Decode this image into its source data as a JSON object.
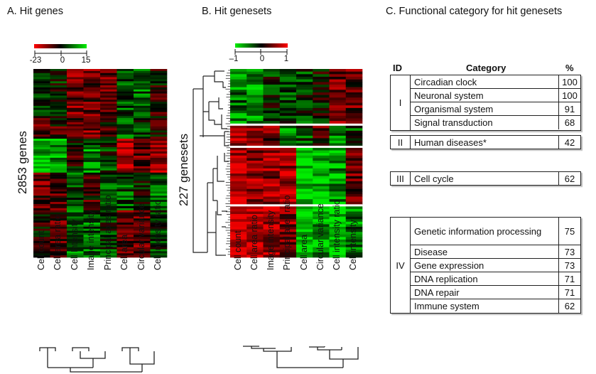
{
  "panels": {
    "a": {
      "title": "A. Hit genes",
      "row_label": "2853 genes"
    },
    "b": {
      "title": "B. Hit genesets",
      "row_label": "227 genesets"
    },
    "c": {
      "title": "C. Functional category for hit genesets"
    }
  },
  "chart_data": [
    {
      "type": "heatmap",
      "title": "A. Hit genes",
      "ylabel": "2853 genes",
      "n_rows": 2853,
      "color_scale": {
        "min": -23,
        "mid": 0,
        "max": 15,
        "colors": [
          "#ff0000",
          "#000000",
          "#00ff00"
        ],
        "tick_labels": [
          "-23",
          "0",
          "15"
        ]
      },
      "columns": [
        "Cell count",
        "Cell area ratio",
        "Cell Intensity",
        "Image intensity",
        "Principal axes ratio",
        "Cell area",
        "Circular variance",
        "Cell intensity ratio"
      ],
      "column_dendrogram": "((Cell count,Cell area ratio),((Cell Intensity,Image intensity),Principal axes ratio)),((Cell area,Circular variance),Cell intensity ratio)",
      "row_blocks_approx": [
        {
          "fraction": 0.25,
          "pattern": [
            -0.1,
            -0.1,
            0.5,
            0.4,
            0.4,
            -0.3,
            -0.4,
            0.1
          ]
        },
        {
          "fraction": 0.12,
          "pattern": [
            0.3,
            0.2,
            0.3,
            0.5,
            0.2,
            -0.5,
            -0.2,
            0.1
          ]
        },
        {
          "fraction": 0.18,
          "pattern": [
            -0.8,
            -0.7,
            0.1,
            -0.5,
            -0.2,
            0.8,
            0.4,
            0.7
          ]
        },
        {
          "fraction": 0.2,
          "pattern": [
            0.4,
            0.4,
            -0.3,
            0.2,
            -0.4,
            -0.3,
            -0.1,
            -0.5
          ]
        },
        {
          "fraction": 0.25,
          "pattern": [
            0.0,
            0.3,
            -0.5,
            -0.4,
            -0.2,
            0.4,
            0.4,
            -0.2
          ]
        }
      ]
    },
    {
      "type": "heatmap",
      "title": "B. Hit genesets",
      "ylabel": "227 genesets",
      "n_rows": 227,
      "color_scale": {
        "min": -1,
        "mid": 0,
        "max": 1,
        "colors": [
          "#00ff00",
          "#000000",
          "#ff0000"
        ],
        "tick_labels": [
          "–1",
          "0",
          "1"
        ]
      },
      "columns": [
        "Cell count",
        "Cell area ratio",
        "Image intensity",
        "Principal axes ratio",
        "Cell area",
        "Circular variance",
        "Cell intensity ratio",
        "Cell intensity"
      ],
      "column_dendrogram": "(((Cell count,Cell area ratio),Image intensity),Principal axes ratio),(((Cell area,Circular variance),Cell intensity ratio),Cell intensity)",
      "row_clusters": [
        {
          "fraction": 0.3,
          "pattern": [
            -0.5,
            -0.6,
            -0.1,
            -0.2,
            -0.2,
            0.0,
            0.5,
            0.4
          ]
        },
        {
          "fraction": 0.11,
          "pattern": [
            0.6,
            0.6,
            0.4,
            -0.5,
            -0.3,
            0.3,
            -0.6,
            -0.3
          ]
        },
        {
          "fraction": 0.31,
          "pattern": [
            0.8,
            0.6,
            0.6,
            0.7,
            -0.9,
            -0.8,
            -0.6,
            0.4
          ]
        },
        {
          "fraction": 0.28,
          "pattern": [
            0.95,
            0.85,
            0.7,
            0.6,
            -0.9,
            -0.7,
            -0.9,
            -0.5
          ]
        }
      ]
    },
    {
      "type": "table",
      "title": "C. Functional category for hit genesets",
      "headers": [
        "ID",
        "Category",
        "%"
      ],
      "groups": [
        {
          "id": "I",
          "rows": [
            {
              "category": "Circadian clock",
              "pct": 100
            },
            {
              "category": "Neuronal system",
              "pct": 100
            },
            {
              "category": "Organismal system",
              "pct": 91
            },
            {
              "category": "Signal transduction",
              "pct": 68
            }
          ]
        },
        {
          "id": "II",
          "rows": [
            {
              "category": "Human diseases*",
              "pct": 42
            }
          ]
        },
        {
          "id": "III",
          "rows": [
            {
              "category": "Cell cycle",
              "pct": 62
            }
          ]
        },
        {
          "id": "IV",
          "rows": [
            {
              "category": "Genetic information processing",
              "pct": 75
            },
            {
              "category": "Disease",
              "pct": 73
            },
            {
              "category": "Gene expression",
              "pct": 73
            },
            {
              "category": "DNA replication",
              "pct": 71
            },
            {
              "category": "DNA repair",
              "pct": 71
            },
            {
              "category": "Immune system",
              "pct": 62
            }
          ]
        }
      ]
    }
  ]
}
